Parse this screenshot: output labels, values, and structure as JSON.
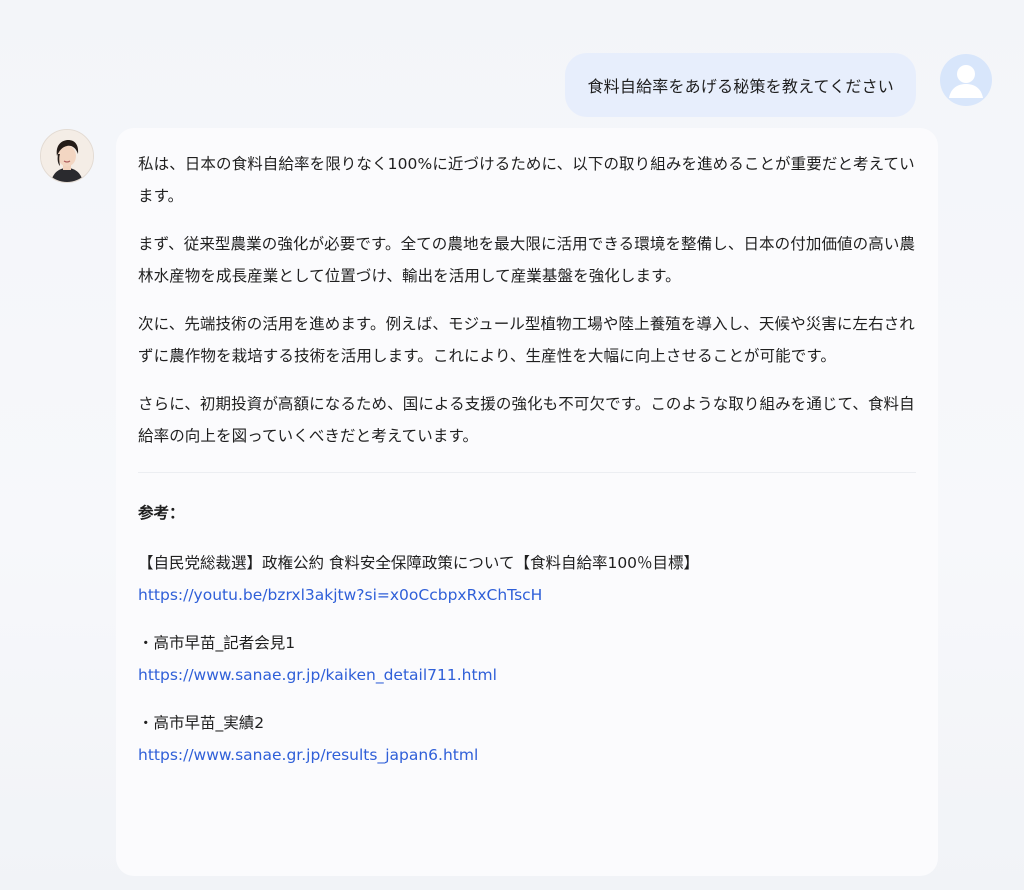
{
  "user_message": {
    "text": "食料自給率をあげる秘策を教えてください"
  },
  "assistant_message": {
    "paragraphs": [
      "私は、日本の食料自給率を限りなく100%に近づけるために、以下の取り組みを進めることが重要だと考えています。",
      "まず、従来型農業の強化が必要です。全ての農地を最大限に活用できる環境を整備し、日本の付加価値の高い農林水産物を成長産業として位置づけ、輸出を活用して産業基盤を強化します。",
      "次に、先端技術の活用を進めます。例えば、モジュール型植物工場や陸上養殖を導入し、天候や災害に左右されずに農作物を栽培する技術を活用します。これにより、生産性を大幅に向上させることが可能です。",
      "さらに、初期投資が高額になるため、国による支援の強化も不可欠です。このような取り組みを通じて、食料自給率の向上を図っていくべきだと考えています。"
    ],
    "references_heading": "参考：",
    "references": [
      {
        "title": "【自民党総裁選】政権公約 食料安全保障政策について【食料自給率100％目標】",
        "url": "https://youtu.be/bzrxl3akjtw?si=x0oCcbpxRxChTscH"
      },
      {
        "title": "・高市早苗_記者会見1",
        "url": "https://www.sanae.gr.jp/kaiken_detail711.html"
      },
      {
        "title": "・高市早苗_実績2",
        "url": "https://www.sanae.gr.jp/results_japan6.html"
      }
    ]
  },
  "icons": {
    "user_avatar": "user-silhouette-icon",
    "assistant_avatar": "assistant-portrait-avatar"
  },
  "colors": {
    "user_bubble": "#e7eefc",
    "link": "#2f5fd8",
    "card": "#fbfbfd"
  }
}
